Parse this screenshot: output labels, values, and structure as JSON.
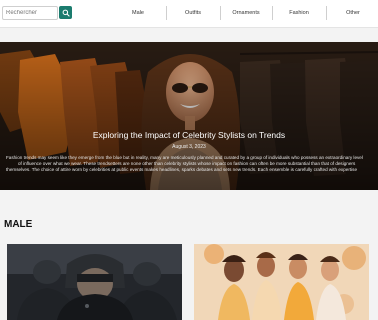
{
  "search": {
    "placeholder": "Rechercher",
    "button_icon": "search-icon"
  },
  "nav": {
    "items": [
      "Male",
      "Outfits",
      "Ornaments",
      "Fashion",
      "Other"
    ]
  },
  "hero": {
    "title": "Exploring the Impact of Celebrity Stylists on Trends",
    "date": "August 3, 2023",
    "body_line1": "Fashion trends may seem like they emerge from the blue but in reality, many are meticulously planned and curated by a group of individuals who possess an extraordinary level",
    "body_line2": "of influence over what we wear. These trendsetters are none other than celebrity stylists whose impact on fashion can often be more substantial than that of designers",
    "body_line3": "themselves. The choice of attire worn by celebrities at public events makes headlines, sparks debates and sets new trends. Each ensemble is carefully crafted with expertise"
  },
  "section": {
    "title": "MALE"
  },
  "colors": {
    "accent": "#1b7c6e"
  }
}
